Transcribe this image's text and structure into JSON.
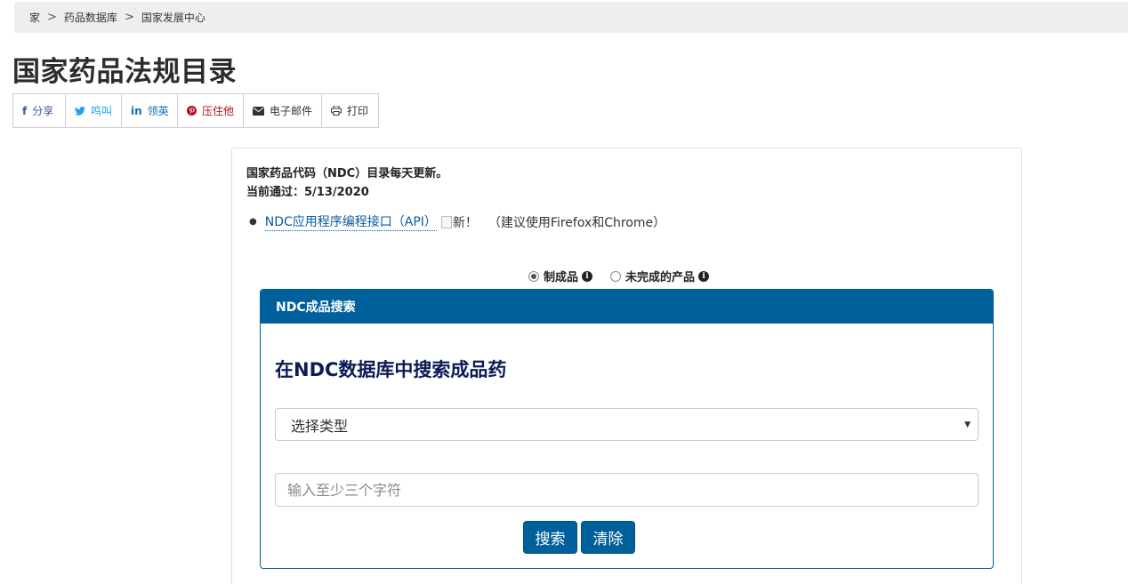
{
  "breadcrumb": {
    "items": [
      "家",
      "药品数据库",
      "国家发展中心"
    ],
    "separator": ">"
  },
  "page_title": "国家药品法规目录",
  "share": {
    "facebook": {
      "icon": "f",
      "label": "分享"
    },
    "twitter": {
      "label": "鸣叫"
    },
    "linkedin": {
      "icon": "in",
      "label": "领英"
    },
    "pinterest": {
      "label": "压住他"
    },
    "email": {
      "label": "电子邮件"
    },
    "print": {
      "label": "打印"
    }
  },
  "notice": {
    "line1": "国家药品代码（NDC）目录每天更新。",
    "line2": "当前通过：5/13/2020"
  },
  "api": {
    "link_text": "NDC应用程序编程接口（API）",
    "new_alt": "新！",
    "note": "（建议使用Firefox和Chrome）"
  },
  "product_type": {
    "options": [
      "制成品",
      "未完成的产品"
    ],
    "selected": "制成品"
  },
  "search_panel": {
    "header": "NDC成品搜索",
    "title": "在NDC数据库中搜索成品药",
    "select_value": "选择类型",
    "input_placeholder": "输入至少三个字符",
    "search_label": "搜索",
    "clear_label": "清除"
  },
  "colors": {
    "brand_blue": "#00609c",
    "title_navy": "#0b1b57",
    "link_blue": "#0a5aa0"
  },
  "icons": [
    "chevron-right-icon",
    "facebook-icon",
    "twitter-icon",
    "linkedin-icon",
    "pinterest-icon",
    "envelope-icon",
    "printer-icon",
    "info-icon",
    "caret-down-icon",
    "broken-image-icon"
  ]
}
